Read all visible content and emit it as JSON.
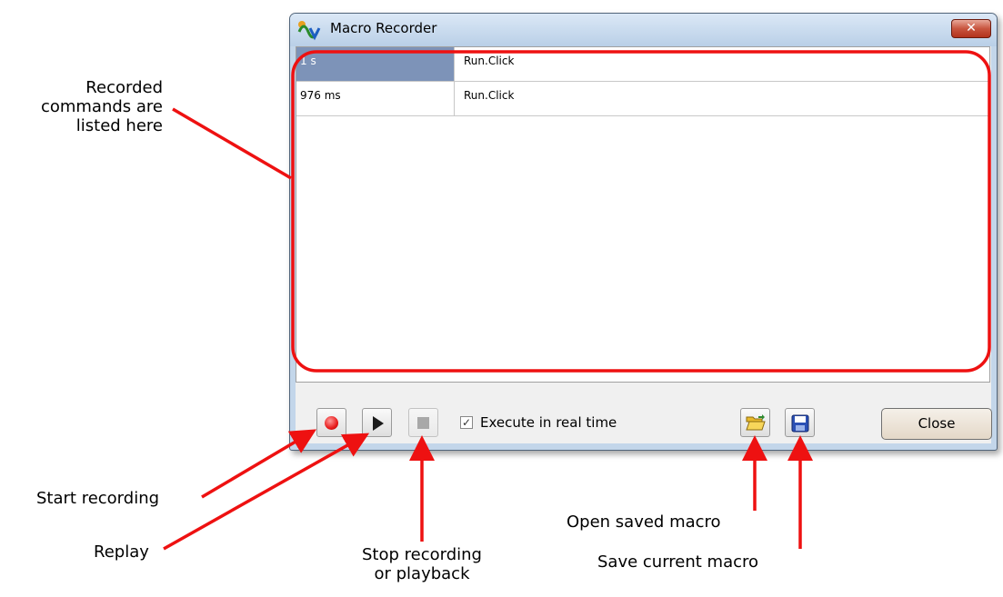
{
  "window": {
    "title": "Macro Recorder",
    "close_glyph": "✕"
  },
  "list": {
    "rows": [
      {
        "time": "1 s",
        "command": "Run.Click",
        "selected": true
      },
      {
        "time": "976 ms",
        "command": "Run.Click",
        "selected": false
      }
    ]
  },
  "toolbar": {
    "record_icon": "record-icon",
    "play_icon": "play-icon",
    "stop_icon": "stop-icon",
    "realtime_checked": true,
    "realtime_label": "Execute in real time",
    "open_icon": "open-folder-icon",
    "save_icon": "floppy-disk-icon",
    "close_label": "Close"
  },
  "annotations": {
    "list_note_line1": "Recorded",
    "list_note_line2": "commands are",
    "list_note_line3": "listed here",
    "start_recording": "Start recording",
    "replay": "Replay",
    "stop_line1": "Stop recording",
    "stop_line2": "or playback",
    "open_saved": "Open saved macro",
    "save_current": "Save current macro"
  },
  "colors": {
    "annotation": "#ee1111",
    "selection": "#7d93b8"
  }
}
